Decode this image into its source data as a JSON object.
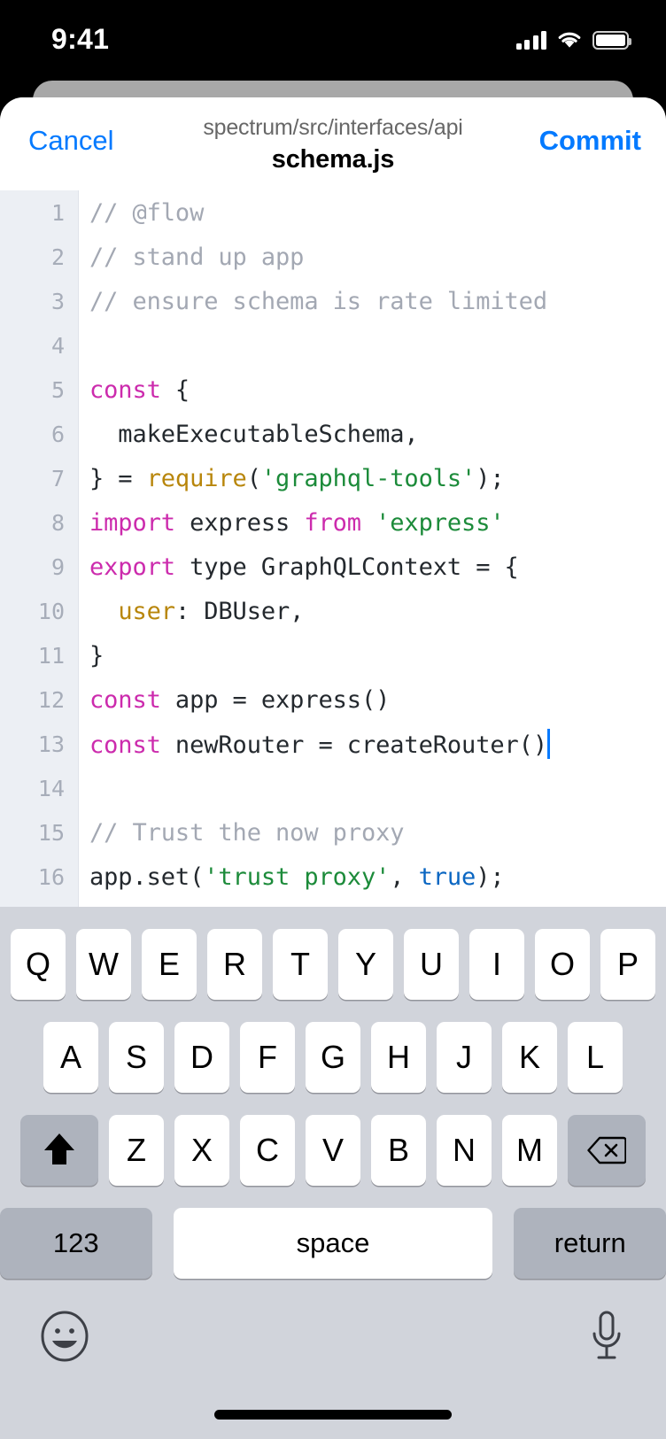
{
  "status_bar": {
    "time": "9:41",
    "cellular_icon": "cellular-signal-icon",
    "wifi_icon": "wifi-icon",
    "battery_icon": "battery-icon"
  },
  "nav_bar": {
    "cancel_label": "Cancel",
    "commit_label": "Commit",
    "path": "spectrum/src/interfaces/api",
    "filename": "schema.js"
  },
  "editor": {
    "accent_color": "#047aff",
    "caret_color": "#057aff",
    "gutter_color": "#eceff4",
    "lines": [
      {
        "num": "1",
        "tokens": [
          {
            "t": "// @flow",
            "c": "comment"
          }
        ]
      },
      {
        "num": "2",
        "tokens": [
          {
            "t": "// stand up app",
            "c": "comment"
          }
        ]
      },
      {
        "num": "3",
        "tokens": [
          {
            "t": "// ensure schema is rate limited",
            "c": "comment"
          }
        ]
      },
      {
        "num": "4",
        "tokens": []
      },
      {
        "num": "5",
        "tokens": [
          {
            "t": "const",
            "c": "keyword"
          },
          {
            "t": " {",
            "c": "plain"
          }
        ]
      },
      {
        "num": "6",
        "tokens": [
          {
            "t": "  makeExecutableSchema,",
            "c": "plain"
          }
        ]
      },
      {
        "num": "7",
        "tokens": [
          {
            "t": "} = ",
            "c": "plain"
          },
          {
            "t": "require",
            "c": "func"
          },
          {
            "t": "(",
            "c": "plain"
          },
          {
            "t": "'graphql-tools'",
            "c": "string"
          },
          {
            "t": ");",
            "c": "plain"
          }
        ]
      },
      {
        "num": "8",
        "tokens": [
          {
            "t": "import",
            "c": "keyword"
          },
          {
            "t": " express ",
            "c": "plain"
          },
          {
            "t": "from",
            "c": "keyword"
          },
          {
            "t": " ",
            "c": "plain"
          },
          {
            "t": "'express'",
            "c": "string"
          }
        ]
      },
      {
        "num": "9",
        "tokens": [
          {
            "t": "export",
            "c": "keyword"
          },
          {
            "t": " type GraphQLContext = {",
            "c": "plain"
          }
        ]
      },
      {
        "num": "10",
        "tokens": [
          {
            "t": "  ",
            "c": "plain"
          },
          {
            "t": "user",
            "c": "prop"
          },
          {
            "t": ": DBUser,",
            "c": "plain"
          }
        ]
      },
      {
        "num": "11",
        "tokens": [
          {
            "t": "}",
            "c": "plain"
          }
        ]
      },
      {
        "num": "12",
        "tokens": [
          {
            "t": "const",
            "c": "keyword"
          },
          {
            "t": " app = express()",
            "c": "plain"
          }
        ]
      },
      {
        "num": "13",
        "tokens": [
          {
            "t": "const",
            "c": "keyword"
          },
          {
            "t": " newRouter = createRouter()",
            "c": "plain"
          }
        ],
        "caret": true
      },
      {
        "num": "14",
        "tokens": []
      },
      {
        "num": "15",
        "tokens": [
          {
            "t": "// Trust the now proxy",
            "c": "comment"
          }
        ]
      },
      {
        "num": "16",
        "tokens": [
          {
            "t": "app.set(",
            "c": "plain"
          },
          {
            "t": "'trust proxy'",
            "c": "string"
          },
          {
            "t": ", ",
            "c": "plain"
          },
          {
            "t": "true",
            "c": "bool"
          },
          {
            "t": ");",
            "c": "plain"
          }
        ]
      }
    ]
  },
  "keyboard": {
    "row1": [
      "Q",
      "W",
      "E",
      "R",
      "T",
      "Y",
      "U",
      "I",
      "O",
      "P"
    ],
    "row2": [
      "A",
      "S",
      "D",
      "F",
      "G",
      "H",
      "J",
      "K",
      "L"
    ],
    "row3_letters": [
      "Z",
      "X",
      "C",
      "V",
      "B",
      "N",
      "M"
    ],
    "shift_icon": "shift-arrow-icon",
    "backspace_icon": "backspace-delete-icon",
    "numbers_label": "123",
    "space_label": "space",
    "return_label": "return",
    "emoji_icon": "emoji-smiley-icon",
    "mic_icon": "microphone-icon",
    "bg_color": "#d1d4db",
    "key_color": "#ffffff",
    "mod_key_color": "#aeb3bd"
  }
}
